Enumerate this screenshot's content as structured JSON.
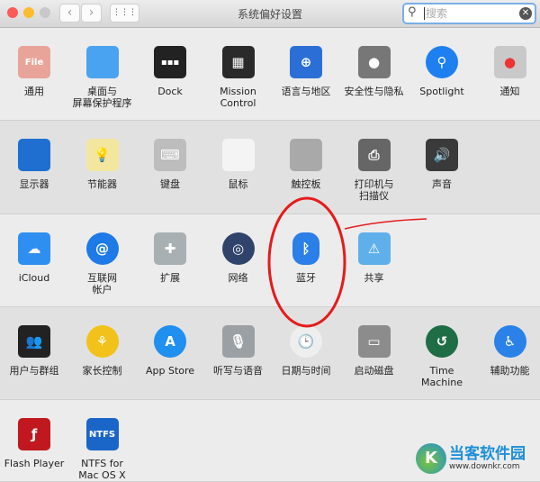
{
  "window": {
    "title": "系统偏好设置",
    "back": "‹",
    "forward": "›",
    "grid": "⋮⋮⋮",
    "search_placeholder": "搜索",
    "search_icon": "search-icon",
    "clear": "✕"
  },
  "rows": [
    [
      {
        "label": "通用",
        "icon": "general-icon",
        "color": "#e9a49a",
        "glyph": "File"
      },
      {
        "label": "桌面与\n屏幕保护程序",
        "icon": "desktop-icon",
        "color": "#4aa3f0",
        "glyph": ""
      },
      {
        "label": "Dock",
        "icon": "dock-icon",
        "color": "#222222",
        "glyph": "▪▪▪"
      },
      {
        "label": "Mission\nControl",
        "icon": "mission-control-icon",
        "color": "#2a2a2a",
        "glyph": "▦"
      },
      {
        "label": "语言与地区",
        "icon": "flag-icon",
        "color": "#2b6fd6",
        "glyph": "⊕"
      },
      {
        "label": "安全性与隐私",
        "icon": "house-lock-icon",
        "color": "#777777",
        "glyph": "●"
      },
      {
        "label": "Spotlight",
        "icon": "spotlight-icon",
        "color": "#1e7ff0",
        "glyph": "⚲"
      },
      {
        "label": "通知",
        "icon": "notifications-icon",
        "color": "#c9c9c9",
        "glyph": "●"
      }
    ],
    [
      {
        "label": "显示器",
        "icon": "display-icon",
        "color": "#1e6fd0",
        "glyph": ""
      },
      {
        "label": "节能器",
        "icon": "lightbulb-icon",
        "color": "#f3e7a0",
        "glyph": "💡"
      },
      {
        "label": "键盘",
        "icon": "keyboard-icon",
        "color": "#bdbdbd",
        "glyph": "⌨"
      },
      {
        "label": "鼠标",
        "icon": "mouse-icon",
        "color": "#f4f4f4",
        "glyph": ""
      },
      {
        "label": "触控板",
        "icon": "trackpad-icon",
        "color": "#a9a9a9",
        "glyph": ""
      },
      {
        "label": "打印机与\n扫描仪",
        "icon": "printer-icon",
        "color": "#666666",
        "glyph": "⎙"
      },
      {
        "label": "声音",
        "icon": "speaker-icon",
        "color": "#3a3a3a",
        "glyph": "🔊"
      }
    ],
    [
      {
        "label": "iCloud",
        "icon": "icloud-icon",
        "color": "#2f8ff0",
        "glyph": "☁"
      },
      {
        "label": "互联网\n帐户",
        "icon": "internet-accounts-icon",
        "color": "#1d7ae6",
        "glyph": "@"
      },
      {
        "label": "扩展",
        "icon": "extensions-icon",
        "color": "#a9b0b4",
        "glyph": "✚"
      },
      {
        "label": "网络",
        "icon": "network-icon",
        "color": "#30436a",
        "glyph": "◎"
      },
      {
        "label": "蓝牙",
        "icon": "bluetooth-icon",
        "color": "#2a7fe8",
        "glyph": "ᛒ"
      },
      {
        "label": "共享",
        "icon": "sharing-icon",
        "color": "#5fb0ea",
        "glyph": "⚠"
      }
    ],
    [
      {
        "label": "用户与群组",
        "icon": "users-icon",
        "color": "#222222",
        "glyph": "👥"
      },
      {
        "label": "家长控制",
        "icon": "parental-controls-icon",
        "color": "#f2c21a",
        "glyph": "⚘"
      },
      {
        "label": "App Store",
        "icon": "app-store-icon",
        "color": "#1f8ff0",
        "glyph": "A"
      },
      {
        "label": "听写与语音",
        "icon": "microphone-icon",
        "color": "#9aa0a4",
        "glyph": "🎙"
      },
      {
        "label": "日期与时间",
        "icon": "clock-icon",
        "color": "#eeeeee",
        "glyph": "🕒"
      },
      {
        "label": "启动磁盘",
        "icon": "disk-icon",
        "color": "#8c8c8c",
        "glyph": "▭"
      },
      {
        "label": "Time Machine",
        "icon": "time-machine-icon",
        "color": "#1f6d45",
        "glyph": "↺"
      },
      {
        "label": "辅助功能",
        "icon": "accessibility-icon",
        "color": "#2a82e8",
        "glyph": "♿"
      }
    ],
    [
      {
        "label": "Flash Player",
        "icon": "flash-icon",
        "color": "#c0181e",
        "glyph": "ƒ"
      },
      {
        "label": "NTFS for\nMac OS X",
        "icon": "ntfs-icon",
        "color": "#1a66c8",
        "glyph": "NTFS"
      }
    ]
  ],
  "watermark": {
    "name": "当客软件园",
    "url": "www.downkr.com"
  },
  "annotation_color": "#e51b1b"
}
